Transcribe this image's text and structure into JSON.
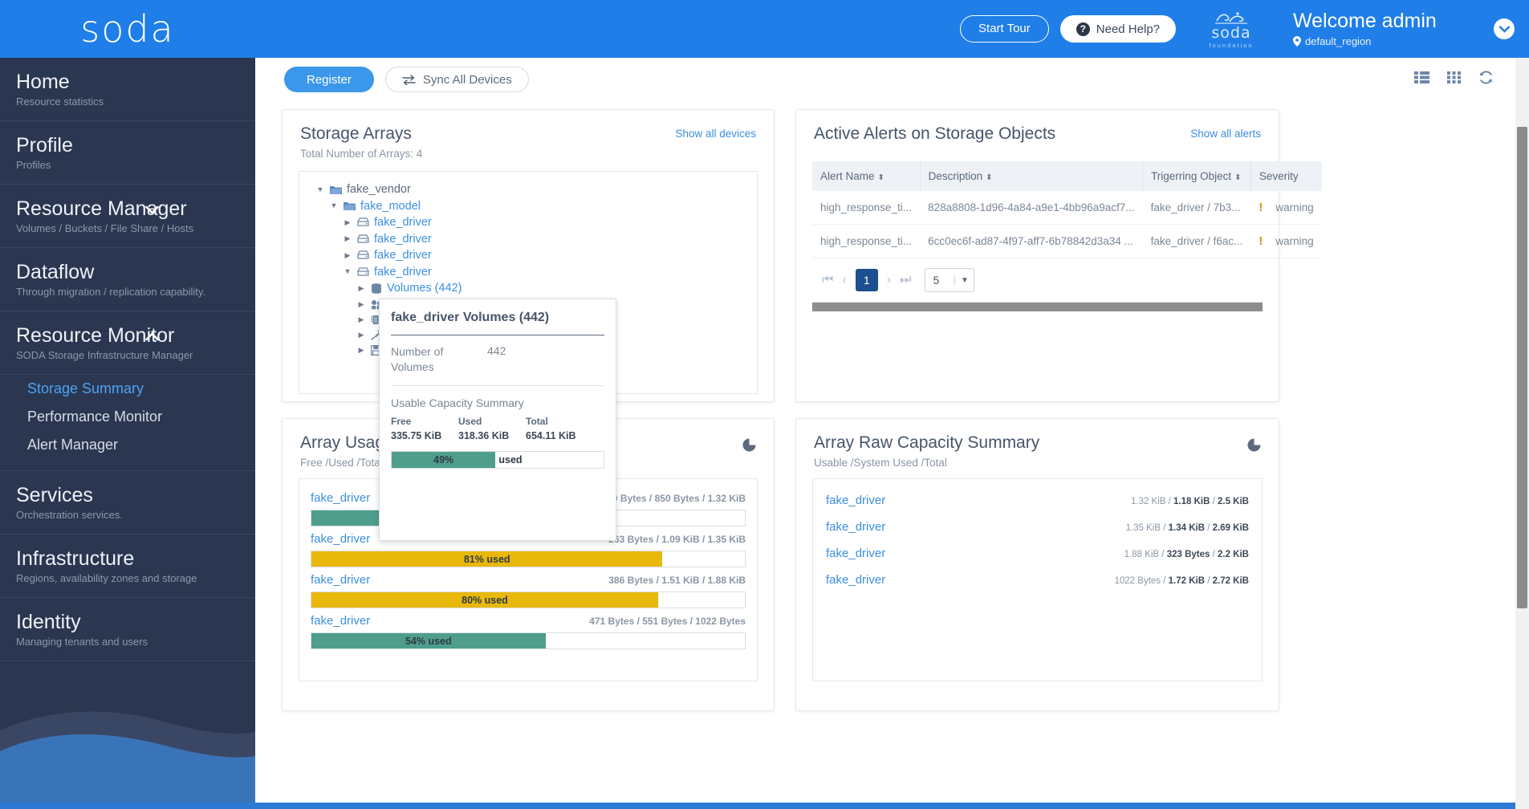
{
  "topbar": {
    "brand": "soda",
    "start_tour": "Start Tour",
    "need_help": "Need Help?",
    "foundation_word": "soda",
    "foundation_sub": "foundation",
    "welcome": "Welcome admin",
    "region": "default_region",
    "caret_icon": "chevron-down-icon",
    "bg_color": "#1f7ee8"
  },
  "sidebar": {
    "items": [
      {
        "label": "Home",
        "sub": "Resource statistics",
        "chevron": "",
        "children": []
      },
      {
        "label": "Profile",
        "sub": "Profiles",
        "chevron": "",
        "children": []
      },
      {
        "label": "Resource Manager",
        "sub": "Volumes / Buckets / File Share / Hosts",
        "chevron": "⌄",
        "children": []
      },
      {
        "label": "Dataflow",
        "sub": "Through migration / replication capability.",
        "chevron": "",
        "children": []
      },
      {
        "label": "Resource Monitor",
        "sub": "SODA Storage Infrastructure Manager",
        "chevron": "⌃",
        "children": [
          {
            "label": "Storage Summary",
            "active": true
          },
          {
            "label": "Performance Monitor",
            "active": false
          },
          {
            "label": "Alert Manager",
            "active": false
          }
        ]
      },
      {
        "label": "Services",
        "sub": "Orchestration services.",
        "chevron": "",
        "children": []
      },
      {
        "label": "Infrastructure",
        "sub": "Regions, availability zones and storage",
        "chevron": "",
        "children": []
      },
      {
        "label": "Identity",
        "sub": "Managing tenants and users",
        "chevron": "",
        "children": []
      }
    ]
  },
  "toolbar": {
    "register": "Register",
    "sync": "Sync All Devices",
    "sync_icon": "sync-arrows-icon",
    "list_view_icon": "list-view-icon",
    "grid_view_icon": "grid-view-icon",
    "refresh_icon": "refresh-icon"
  },
  "storage_arrays": {
    "title": "Storage Arrays",
    "subtitle": "Total Number of Arrays: 4",
    "link": "Show all devices",
    "tree": [
      {
        "depth": 0,
        "toggle": "▼",
        "icon": "folder-open-icon",
        "label": "fake_vendor",
        "root": true
      },
      {
        "depth": 1,
        "toggle": "▼",
        "icon": "folder-open-icon",
        "label": "fake_model",
        "root": false
      },
      {
        "depth": 2,
        "toggle": "▶",
        "icon": "array-icon",
        "label": "fake_driver",
        "root": false
      },
      {
        "depth": 2,
        "toggle": "▶",
        "icon": "array-icon",
        "label": "fake_driver",
        "root": false
      },
      {
        "depth": 2,
        "toggle": "▶",
        "icon": "array-icon",
        "label": "fake_driver",
        "root": false
      },
      {
        "depth": 2,
        "toggle": "▼",
        "icon": "array-icon",
        "label": "fake_driver",
        "root": false
      },
      {
        "depth": 3,
        "toggle": "▶",
        "icon": "database-icon",
        "label": "Volumes (442)",
        "root": false
      },
      {
        "depth": 3,
        "toggle": "▶",
        "icon": "cubes-icon",
        "label": "",
        "root": false
      },
      {
        "depth": 3,
        "toggle": "▶",
        "icon": "chip-icon",
        "label": "",
        "root": false
      },
      {
        "depth": 3,
        "toggle": "▶",
        "icon": "plug-icon",
        "label": "",
        "root": false
      },
      {
        "depth": 3,
        "toggle": "▶",
        "icon": "floppy-save-icon",
        "label": "",
        "root": false
      }
    ]
  },
  "tooltip": {
    "title": "fake_driver Volumes (442)",
    "row_key": "Number of Volumes",
    "row_value": "442",
    "section": "Usable Capacity Summary",
    "free_label": "Free",
    "used_label": "Used",
    "total_label": "Total",
    "free_value": "335.75 KiB",
    "used_value": "318.36 KiB",
    "total_value": "654.11 KiB",
    "percent": 49,
    "percent_label": "49%",
    "used_word": "used",
    "bar_color": "#4f9e8c"
  },
  "alerts": {
    "title": "Active Alerts on Storage Objects",
    "link": "Show all alerts",
    "columns": [
      "Alert Name",
      "Description",
      "Trigerring Object",
      "Severity"
    ],
    "rows": [
      {
        "name": "high_response_ti...",
        "description": "828a8808-1d96-4a84-a9e1-4bb96a9acf7...",
        "object": "fake_driver / 7b3...",
        "severity": "warning"
      },
      {
        "name": "high_response_ti...",
        "description": "6cc0ec6f-ad87-4f97-aff7-6b78842d3a34 ...",
        "object": "fake_driver / f6ac...",
        "severity": "warning"
      }
    ],
    "pager": {
      "first_icon": "first-page-icon",
      "prev_icon": "prev-page-icon",
      "current": "1",
      "next_icon": "next-page-icon",
      "last_icon": "last-page-icon",
      "page_size": "5"
    }
  },
  "array_usage": {
    "title": "Array Usage Summary",
    "subtitle": "Free /Used /Total",
    "pie_icon": "pie-chart-icon",
    "rows": [
      {
        "name": "fake_driver",
        "values": "500 Bytes / 850 Bytes / 1.32 KiB",
        "percent": 63,
        "label": "63% used",
        "color": "#4f9e8c"
      },
      {
        "name": "fake_driver",
        "values": "263 Bytes / 1.09 KiB / 1.35 KiB",
        "percent": 81,
        "label": "81% used",
        "color": "#e8b80b"
      },
      {
        "name": "fake_driver",
        "values": "386 Bytes / 1.51 KiB / 1.88 KiB",
        "percent": 80,
        "label": "80% used",
        "color": "#e8b80b"
      },
      {
        "name": "fake_driver",
        "values": "471 Bytes / 551 Bytes / 1022 Bytes",
        "percent": 54,
        "label": "54% used",
        "color": "#4f9e8c"
      }
    ]
  },
  "array_raw": {
    "title": "Array Raw Capacity Summary",
    "subtitle": "Usable /System Used /Total",
    "pie_icon": "pie-chart-icon",
    "rows": [
      {
        "name": "fake_driver",
        "usable": "1.32 KiB",
        "system_used": "1.18 KiB",
        "total": "2.5 KiB"
      },
      {
        "name": "fake_driver",
        "usable": "1.35 KiB",
        "system_used": "1.34 KiB",
        "total": "2.69 KiB"
      },
      {
        "name": "fake_driver",
        "usable": "1.88 KiB",
        "system_used": "323 Bytes",
        "total": "2.2 KiB"
      },
      {
        "name": "fake_driver",
        "usable": "1022 Bytes",
        "system_used": "1.72 KiB",
        "total": "2.72 KiB"
      }
    ]
  }
}
